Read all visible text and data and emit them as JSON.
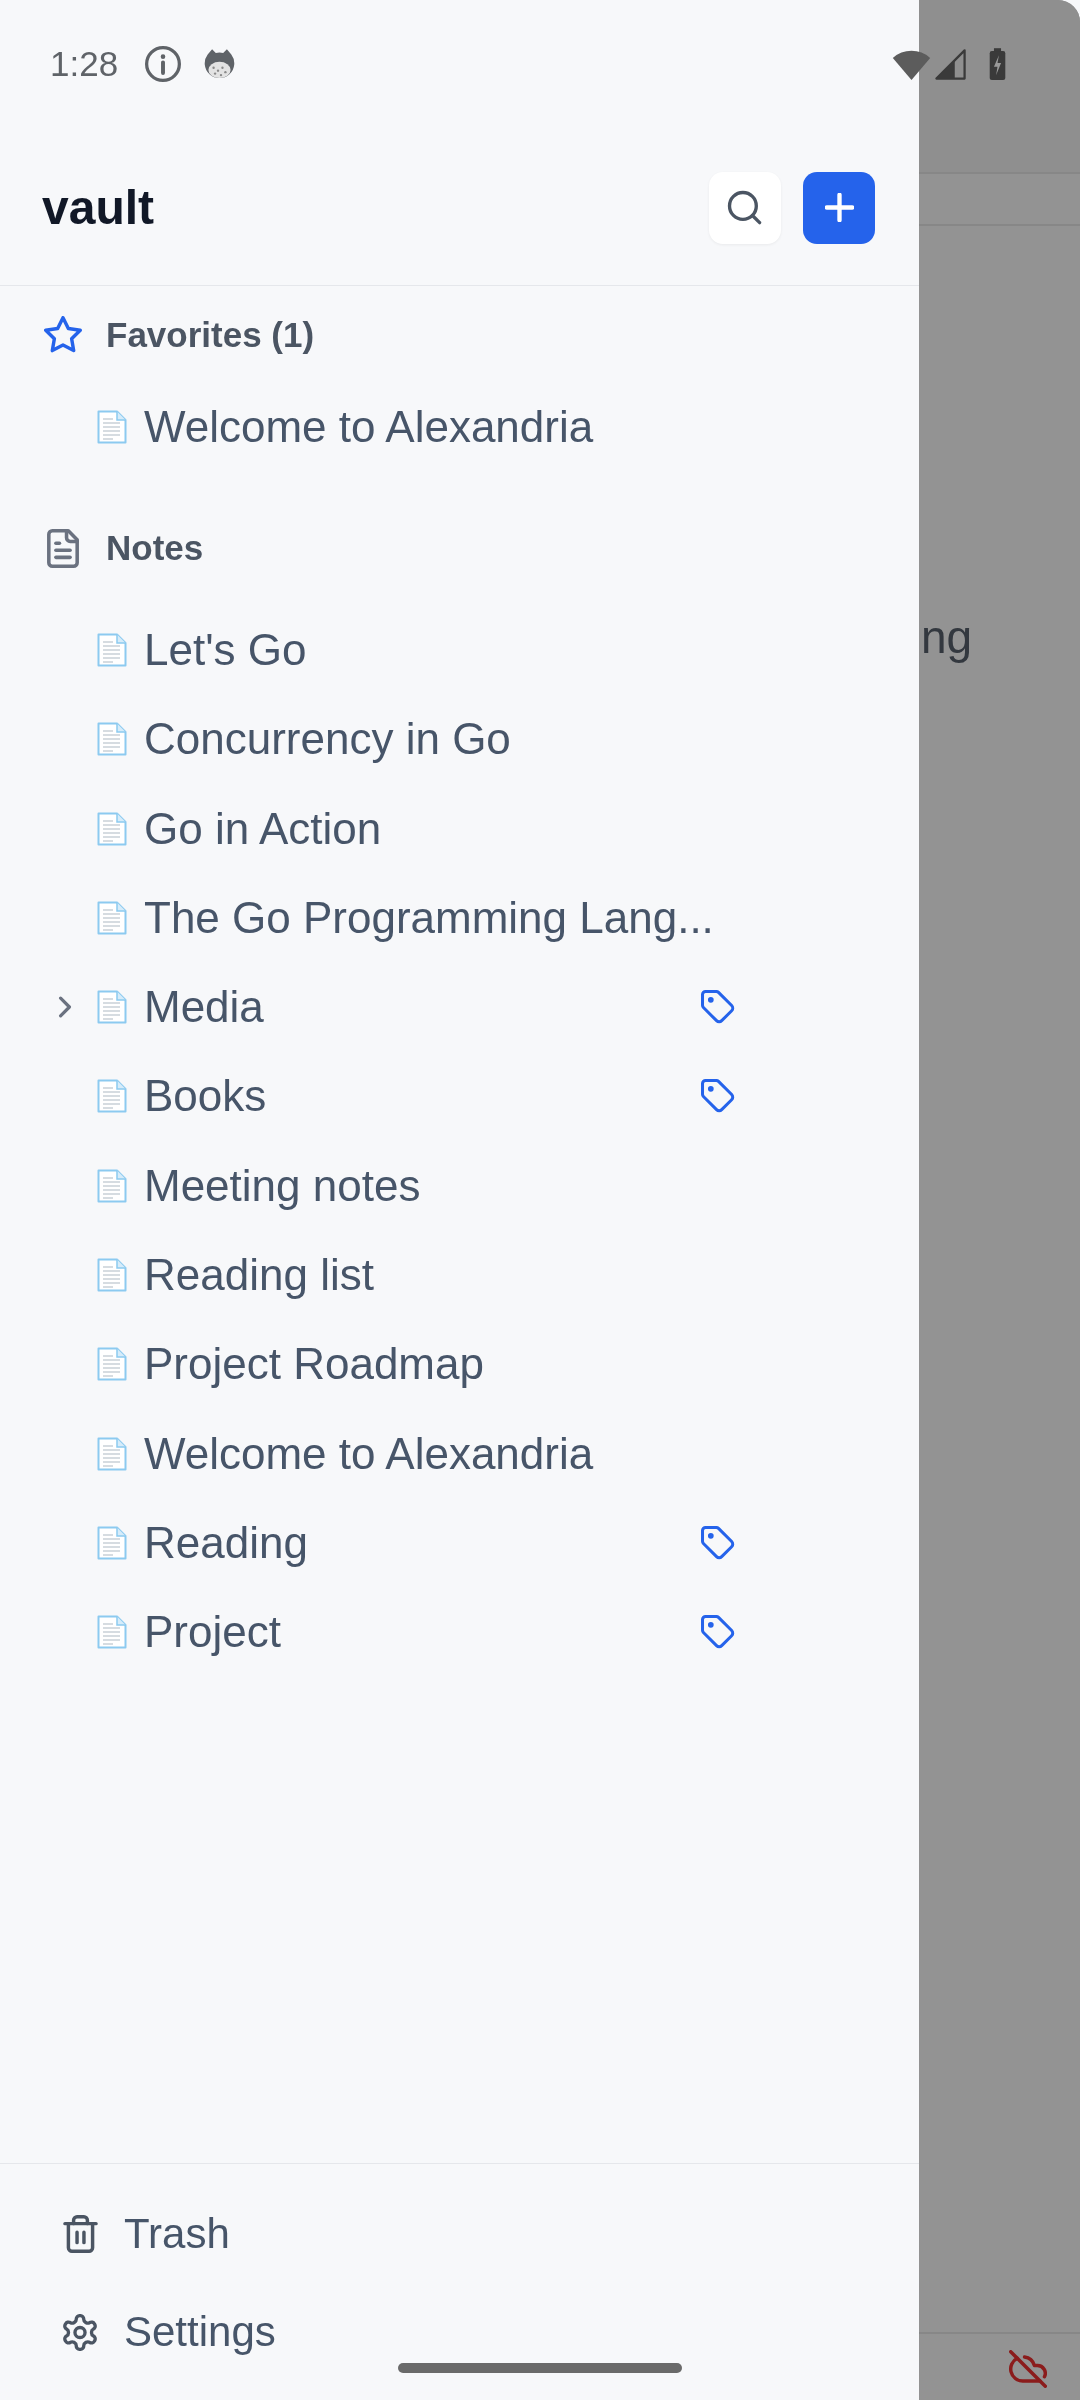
{
  "status_bar": {
    "time": "1:28"
  },
  "header": {
    "title": "vault"
  },
  "sections": [
    {
      "kind": "favorites",
      "label": "Favorites (1)",
      "items": [
        {
          "title": "Welcome to Alexandria",
          "expandable": false,
          "tagged": false
        }
      ]
    },
    {
      "kind": "notes",
      "label": "Notes",
      "items": [
        {
          "title": "Let's Go",
          "expandable": false,
          "tagged": false
        },
        {
          "title": "Concurrency in Go",
          "expandable": false,
          "tagged": false
        },
        {
          "title": "Go in Action",
          "expandable": false,
          "tagged": false
        },
        {
          "title": "The Go Programming Lang...",
          "expandable": false,
          "tagged": false
        },
        {
          "title": "Media",
          "expandable": true,
          "expanded": false,
          "tagged": true
        },
        {
          "title": "Books",
          "expandable": false,
          "tagged": true
        },
        {
          "title": "Meeting notes",
          "expandable": false,
          "tagged": false
        },
        {
          "title": "Reading list",
          "expandable": false,
          "tagged": false
        },
        {
          "title": "Project Roadmap",
          "expandable": false,
          "tagged": false
        },
        {
          "title": "Welcome to Alexandria",
          "expandable": false,
          "tagged": false
        },
        {
          "title": "Reading",
          "expandable": false,
          "tagged": true
        },
        {
          "title": "Project",
          "expandable": false,
          "tagged": true
        }
      ]
    }
  ],
  "footer": [
    {
      "kind": "trash",
      "label": "Trash"
    },
    {
      "kind": "settings",
      "label": "Settings"
    }
  ],
  "backdrop": {
    "text": "ng"
  }
}
